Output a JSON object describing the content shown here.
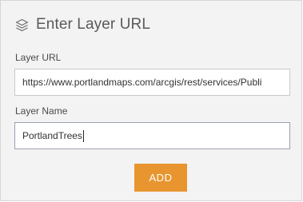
{
  "header": {
    "icon": "layers-icon",
    "title": "Enter Layer URL"
  },
  "layer_url": {
    "label": "Layer URL",
    "value": "https://www.portlandmaps.com/arcgis/rest/services/Publi"
  },
  "layer_name": {
    "label": "Layer Name",
    "value": "PortlandTrees"
  },
  "actions": {
    "add_label": "ADD"
  },
  "colors": {
    "panel_background": "#f3f3f3",
    "accent": "#e8952f",
    "title_text": "#5a5a5a"
  }
}
